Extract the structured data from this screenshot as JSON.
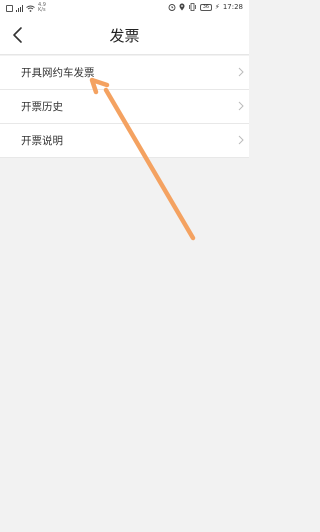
{
  "status_bar": {
    "net_speed_top": "4.9",
    "net_speed_bottom": "K/s",
    "battery": "36",
    "time": "17:28"
  },
  "header": {
    "title": "发票",
    "back_icon": "chevron-left-icon"
  },
  "menu": {
    "items": [
      {
        "label": "开具网约车发票",
        "icon": "chevron-right-icon"
      },
      {
        "label": "开票历史",
        "icon": "chevron-right-icon"
      },
      {
        "label": "开票说明",
        "icon": "chevron-right-icon"
      }
    ]
  },
  "annotation": {
    "arrow_color": "#f4a261"
  }
}
